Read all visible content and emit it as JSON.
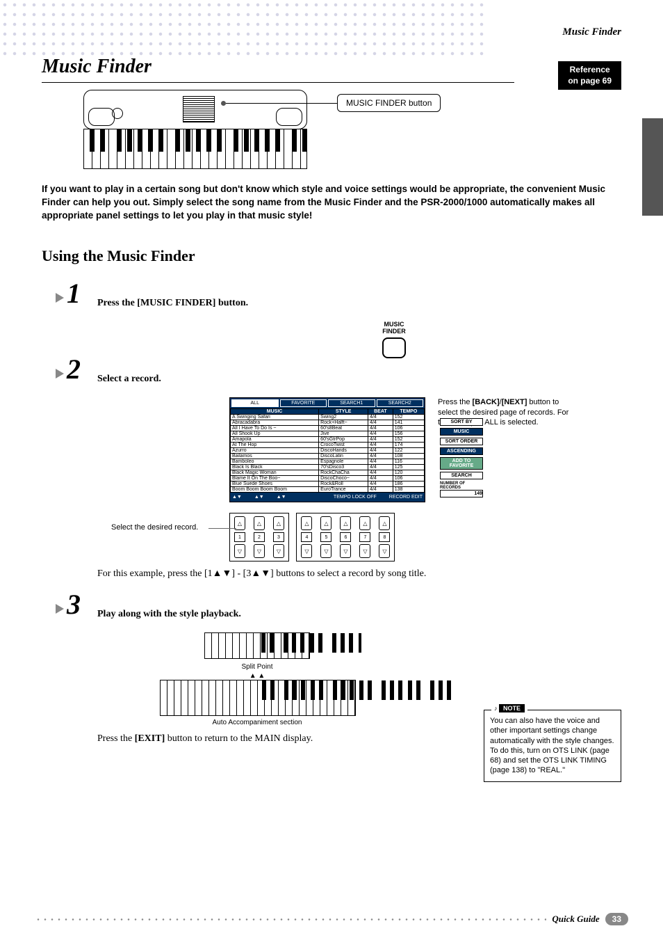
{
  "header": {
    "title": "Music Finder"
  },
  "title": "Music Finder",
  "refbox": {
    "line1": "Reference",
    "line2": "on page 69"
  },
  "callout": "MUSIC FINDER button",
  "intro": "If you want to play in a certain song but don't know which style and voice settings would be appropriate, the convenient Music Finder can help you out. Simply select the song name from the Music Finder and the PSR-2000/1000 automatically makes all appropriate panel settings to let you play in that music style!",
  "section": "Using the Music Finder",
  "steps": {
    "s1": {
      "num": "1",
      "text": "Press the [MUSIC FINDER] button."
    },
    "s2": {
      "num": "2",
      "text": "Select a record."
    },
    "s3": {
      "num": "3",
      "text": "Play along with the style playback."
    }
  },
  "mfbutton": {
    "line1": "MUSIC",
    "line2": "FINDER"
  },
  "lcd": {
    "tabs": {
      "all": "ALL",
      "fav": "FAVORITE",
      "s1": "SEARCH1",
      "s2": "SEARCH2"
    },
    "cols": {
      "music": "MUSIC",
      "style": "STYLE",
      "beat": "BEAT",
      "tempo": "TEMPO"
    },
    "rows": [
      {
        "music": "A Swinging Safari",
        "style": "Swing2",
        "beat": "4/4",
        "tempo": "152"
      },
      {
        "music": "Abracadabra",
        "style": "Rock+Halft~",
        "beat": "4/4",
        "tempo": "141"
      },
      {
        "music": "All I Have To Do Is ~",
        "style": "60's8Beat",
        "beat": "4/4",
        "tempo": "106"
      },
      {
        "music": "All Shook Up",
        "style": "Jive",
        "beat": "4/4",
        "tempo": "156"
      },
      {
        "music": "Amapola",
        "style": "60'sGtrPop",
        "beat": "4/4",
        "tempo": "152"
      },
      {
        "music": "At The Hop",
        "style": "CrocoTwist",
        "beat": "4/4",
        "tempo": "174"
      },
      {
        "music": "Azurro",
        "style": "DiscoHands",
        "beat": "4/4",
        "tempo": "122"
      },
      {
        "music": "Bailamos",
        "style": "DiscoLatin",
        "beat": "4/4",
        "tempo": "108"
      },
      {
        "music": "Bamboleo",
        "style": "Espagnole",
        "beat": "4/4",
        "tempo": "116"
      },
      {
        "music": "Black Is Black",
        "style": "70'sDisco3",
        "beat": "4/4",
        "tempo": "125"
      },
      {
        "music": "Black Magic Woman",
        "style": "RockChaCha",
        "beat": "4/4",
        "tempo": "120"
      },
      {
        "music": "Blame It On The Boo~",
        "style": "DiscoChoco~",
        "beat": "4/4",
        "tempo": "106"
      },
      {
        "music": "Blue Suede Shoes",
        "style": "Rock&Roll",
        "beat": "4/4",
        "tempo": "186"
      },
      {
        "music": "Boom Boom Boom Boom",
        "style": "EuroTrance",
        "beat": "4/4",
        "tempo": "138"
      }
    ],
    "side": {
      "sortby": "SORT BY",
      "music": "MUSIC",
      "sortorder": "SORT ORDER",
      "ascending": "ASCENDING",
      "addto": "ADD TO FAVORITE",
      "search": "SEARCH",
      "numrec1": "NUMBER OF",
      "numrec2": "RECORDS",
      "count": "149"
    },
    "bottom": {
      "tempolock": "TEMPO LOCK OFF",
      "recedit": "RECORD EDIT"
    }
  },
  "sidenote": "Press the [BACK]/[NEXT] button to select the desired page of records. For this example, ALL is selected.",
  "selectnote": "Select the desired record.",
  "buttons": {
    "nums": [
      "1",
      "2",
      "3",
      "4",
      "5",
      "6",
      "7",
      "8"
    ]
  },
  "example": "For this example, press the [1▲▼] - [3▲▼] buttons to select a record by song title.",
  "split": "Split Point",
  "autoaccomp": "Auto Accompaniment section",
  "notebox": {
    "label": "NOTE",
    "text": "You can also have the voice and other important settings change automatically with the style changes. To do this, turn on OTS LINK (page 68) and set the OTS LINK TIMING (page 138) to \"REAL.\""
  },
  "exit": "Press the [EXIT] button to return to the MAIN display.",
  "footer": {
    "text": "Quick Guide",
    "page": "33"
  }
}
